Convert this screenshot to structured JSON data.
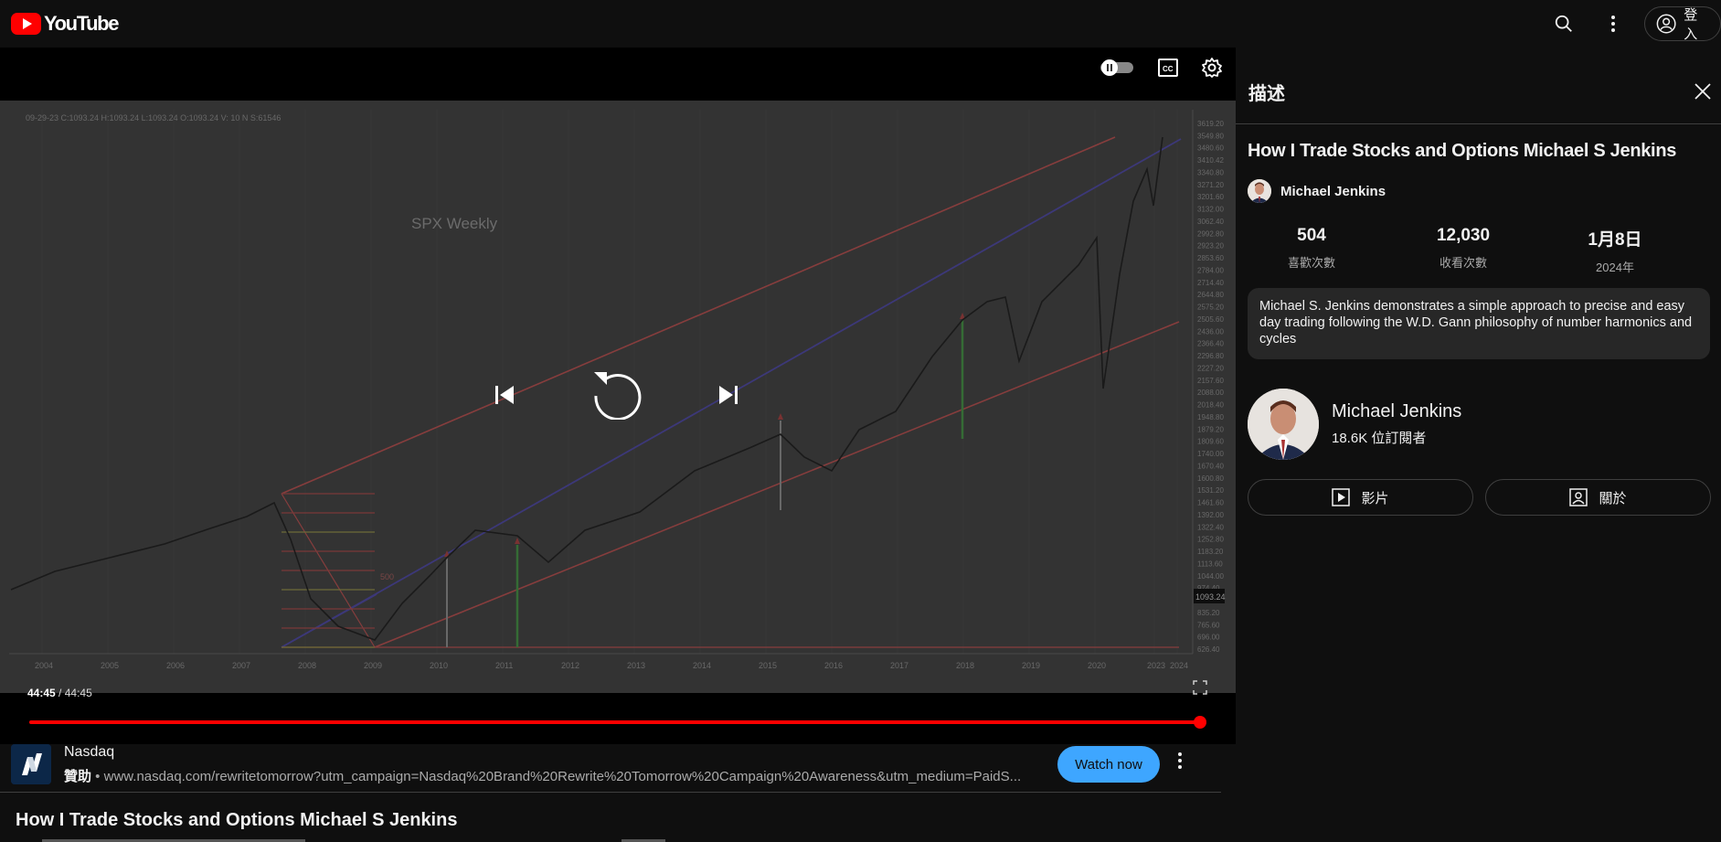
{
  "header": {
    "logo_text": "YouTube",
    "signin_label": "登入"
  },
  "player": {
    "chart_title": "SPX Weekly",
    "chart_header": "09-29-23  C:1093.24  H:1093.24  L:1093.24  O:1093.24  V: 10  N  S:61546",
    "time_current": "44:45",
    "time_separator": " / ",
    "time_total": "44:45",
    "progress": 1.0,
    "x_labels": [
      "2004",
      "2005",
      "2006",
      "2007",
      "2008",
      "2009",
      "2010",
      "2011",
      "2012",
      "2013",
      "2014",
      "2015",
      "2016",
      "2017",
      "2018",
      "2019",
      "2020",
      "2023",
      "2024"
    ],
    "y_labels": [
      "3619.20",
      "3549.80",
      "3480.60",
      "3410.42",
      "3340.80",
      "3271.20",
      "3201.60",
      "3132.00",
      "3062.40",
      "2992.80",
      "2923.20",
      "2853.60",
      "2784.00",
      "2714.40",
      "2644.80",
      "2575.20",
      "2505.60",
      "2436.00",
      "2366.40",
      "2296.80",
      "2227.20",
      "2157.60",
      "2088.00",
      "2018.40",
      "1948.80",
      "1879.20",
      "1809.60",
      "1740.00",
      "1670.40",
      "1600.80",
      "1531.20",
      "1461.60",
      "1392.00",
      "1322.40",
      "1252.80",
      "1183.20",
      "1113.60",
      "1044.00",
      "974.40",
      "904.80",
      "835.20",
      "765.60",
      "696.00",
      "626.40"
    ],
    "price_tag": "1093.24",
    "level_label": "500"
  },
  "ad": {
    "advertiser": "Nasdaq",
    "sponsored_label": "贊助",
    "bullet": " • ",
    "url": "www.nasdaq.com/rewritetomorrow?utm_campaign=Nasdaq%20Brand%20Rewrite%20Tomorrow%20Campaign%20Awareness&utm_medium=PaidS...",
    "cta": "Watch now"
  },
  "video": {
    "title": "How I Trade Stocks and Options Michael S Jenkins"
  },
  "panel": {
    "heading": "描述",
    "title": "How I Trade Stocks and Options Michael S Jenkins",
    "channel_name": "Michael Jenkins",
    "stats": [
      {
        "value": "504",
        "label": "喜歡次數"
      },
      {
        "value": "12,030",
        "label": "收看次數"
      },
      {
        "value": "1月8日",
        "label": "2024年"
      }
    ],
    "description": "Michael S. Jenkins demonstrates a simple  approach to precise and easy day trading following the W.D. Gann philosophy of number harmonics and cycles",
    "channel": {
      "name": "Michael Jenkins",
      "subscribers": "18.6K 位訂閱者"
    },
    "buttons": {
      "videos": "影片",
      "about": "關於"
    }
  }
}
